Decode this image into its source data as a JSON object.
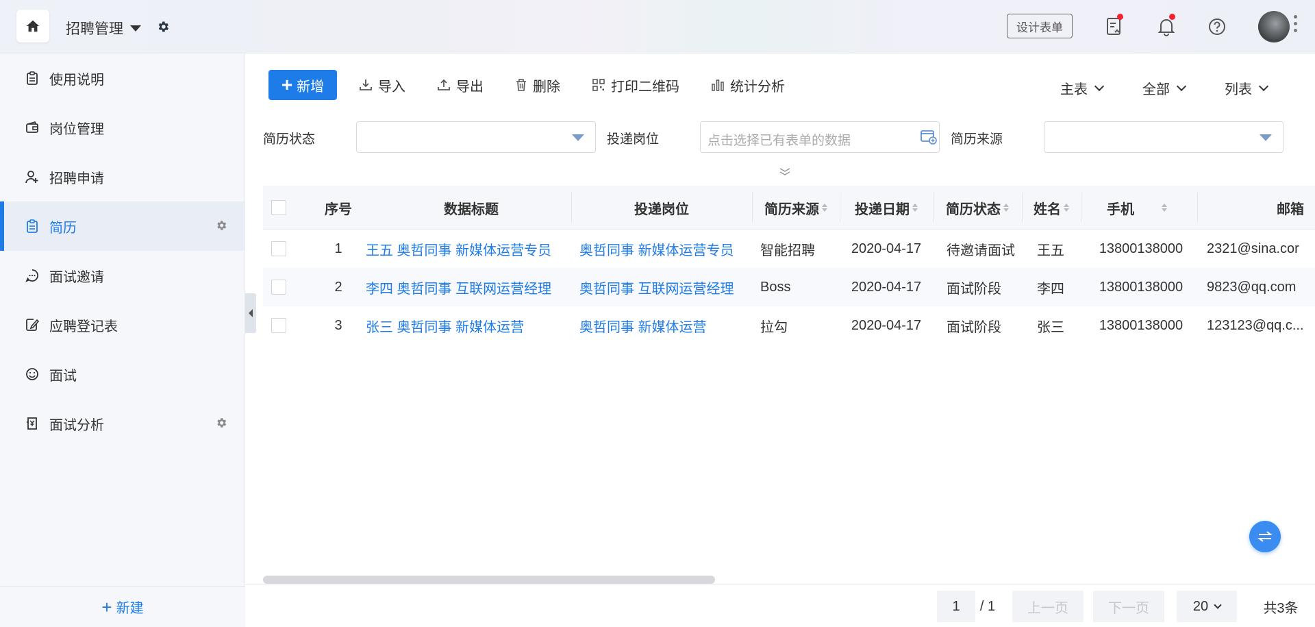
{
  "header": {
    "app_name": "招聘管理",
    "design_form_label": "设计表单"
  },
  "sidebar": {
    "items": [
      {
        "label": "使用说明",
        "icon": "clipboard-icon"
      },
      {
        "label": "岗位管理",
        "icon": "wallet-icon"
      },
      {
        "label": "招聘申请",
        "icon": "user-add-icon"
      },
      {
        "label": "简历",
        "icon": "clipboard-icon",
        "active": true
      },
      {
        "label": "面试邀请",
        "icon": "chat-icon"
      },
      {
        "label": "应聘登记表",
        "icon": "edit-doc-icon"
      },
      {
        "label": "面试",
        "icon": "smile-icon"
      },
      {
        "label": "面试分析",
        "icon": "report-icon"
      }
    ],
    "new_label": "新建"
  },
  "toolbar": {
    "add_label": "新增",
    "import_label": "导入",
    "export_label": "导出",
    "delete_label": "删除",
    "print_qr_label": "打印二维码",
    "stats_label": "统计分析",
    "view_main": "主表",
    "view_all": "全部",
    "view_list": "列表"
  },
  "filters": {
    "status_label": "简历状态",
    "position_label": "投递岗位",
    "position_placeholder": "点击选择已有表单的数据",
    "source_label": "简历来源"
  },
  "table": {
    "headers": {
      "index": "序号",
      "title": "数据标题",
      "position": "投递岗位",
      "source": "简历来源",
      "date": "投递日期",
      "status": "简历状态",
      "name": "姓名",
      "phone": "手机",
      "email": "邮箱"
    },
    "rows": [
      {
        "index": "1",
        "title": "王五 奥哲同事 新媒体运营专员",
        "position": "奥哲同事 新媒体运营专员",
        "source": "智能招聘",
        "date": "2020-04-17",
        "status": "待邀请面试",
        "name": "王五",
        "phone": "13800138000",
        "email": "2321@sina.cor"
      },
      {
        "index": "2",
        "title": "李四 奥哲同事 互联网运营经理",
        "position": "奥哲同事 互联网运营经理",
        "source": "Boss",
        "date": "2020-04-17",
        "status": "面试阶段",
        "name": "李四",
        "phone": "13800138000",
        "email": "9823@qq.com"
      },
      {
        "index": "3",
        "title": "张三 奥哲同事 新媒体运营",
        "position": "奥哲同事 新媒体运营",
        "source": "拉勾",
        "date": "2020-04-17",
        "status": "面试阶段",
        "name": "张三",
        "phone": "13800138000",
        "email": "123123@qq.c..."
      }
    ]
  },
  "pagination": {
    "current_page": "1",
    "total_pages": "/ 1",
    "prev_label": "上一页",
    "next_label": "下一页",
    "page_size": "20",
    "total_label": "共3条"
  },
  "colors": {
    "accent": "#1e7ce8",
    "notification_dot": "#f5222d"
  }
}
